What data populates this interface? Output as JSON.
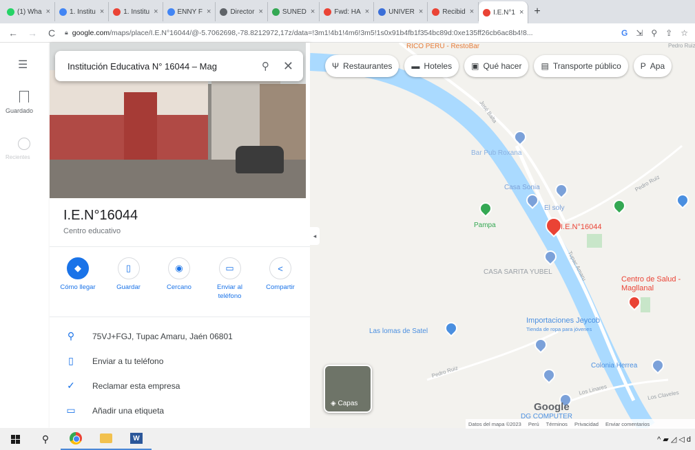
{
  "browser": {
    "tabs": [
      {
        "label": "(1) Wha",
        "color": "#25d366"
      },
      {
        "label": "1. Institu",
        "color": "#4285f4"
      },
      {
        "label": "1. Institu",
        "color": "#ea4335"
      },
      {
        "label": "ENNY F",
        "color": "#4285f4"
      },
      {
        "label": "Director",
        "color": "#5f6368"
      },
      {
        "label": "SUNED",
        "color": "#34a853"
      },
      {
        "label": "Fwd: HA",
        "color": "#ea4335"
      },
      {
        "label": "UNIVER",
        "color": "#3b6fd8"
      },
      {
        "label": "Recibid",
        "color": "#ea4335"
      },
      {
        "label": "I.E.N°1",
        "color": "#ea4335"
      }
    ],
    "tab_close": "×",
    "new_tab": "+",
    "url_host": "google.com",
    "url_rest": "/maps/place/I.E.N°16044/@-5.7062698,-78.8212972,17z/data=!3m1!4b1!4m6!3m5!1s0x91b4fb1f354bc89d:0xe135ff26cb6ac8b4!8..."
  },
  "rail": {
    "saved_label": "Guardado",
    "recent_label": "Recientes"
  },
  "search": {
    "value": "Institución Educativa N° 16044 – Mag"
  },
  "place": {
    "title": "I.E.N°16044",
    "category": "Centro educativo",
    "actions": [
      {
        "label": "Cómo llegar",
        "icon": "directions-icon",
        "glyph": "◆"
      },
      {
        "label": "Guardar",
        "icon": "bookmark-icon",
        "glyph": "▯"
      },
      {
        "label": "Cercano",
        "icon": "nearby-icon",
        "glyph": "◉"
      },
      {
        "label": "Enviar al teléfono",
        "icon": "send-to-phone-icon",
        "glyph": "▭"
      },
      {
        "label": "Compartir",
        "icon": "share-icon",
        "glyph": "<"
      }
    ],
    "info": [
      {
        "text": "75VJ+FGJ, Tupac Amaru, Jaén 06801",
        "icon": "location-pin-icon",
        "glyph": "⚲"
      },
      {
        "text": "Enviar a tu teléfono",
        "icon": "phone-icon",
        "glyph": "▯"
      },
      {
        "text": "Reclamar esta empresa",
        "icon": "shield-check-icon",
        "glyph": "✓"
      },
      {
        "text": "Añadir una etiqueta",
        "icon": "label-icon",
        "glyph": "▭"
      }
    ]
  },
  "map": {
    "chips": [
      {
        "label": "Restaurantes",
        "glyph": "Ψ"
      },
      {
        "label": "Hoteles",
        "glyph": "▬"
      },
      {
        "label": "Qué hacer",
        "glyph": "▣"
      },
      {
        "label": "Transporte público",
        "glyph": "▤"
      },
      {
        "label": "Apa",
        "glyph": "P"
      }
    ],
    "labels": {
      "rico_peru": "RICO PERU - RestoBar",
      "bar_pub": "Bar Pub Roxana",
      "casa_sonia": "Casa Sonia",
      "el_soly": "El soly",
      "pampa": "Pampa",
      "selected": "I.E.N°16044",
      "casa_sarita": "CASA SARITA YUBEL",
      "centro_salud": "Centro de Salud - Magllanal",
      "importaciones": "Importaciones Jeycob",
      "importaciones_sub": "Tienda de ropa para jóvenes",
      "las_lomas": "Las lomas de Satel",
      "colonia": "Colonia Herrea",
      "dg_computer": "DG COMPUTER",
      "street_jose_balta": "José Balta",
      "street_tupac": "Tupac Amaru",
      "street_pedro_ruiz": "Pedro Ruiz",
      "street_los_linares": "Los Linares",
      "street_los_claveles": "Los Claveles"
    },
    "layers_label": "Capas",
    "google": "Google",
    "footer": [
      "Datos del mapa ©2023",
      "Perú",
      "Términos",
      "Privacidad",
      "Enviar comentarios"
    ]
  },
  "taskbar": {
    "search_glyph": "⚲",
    "tray": "^ ▰ ◿ ◁ d"
  }
}
